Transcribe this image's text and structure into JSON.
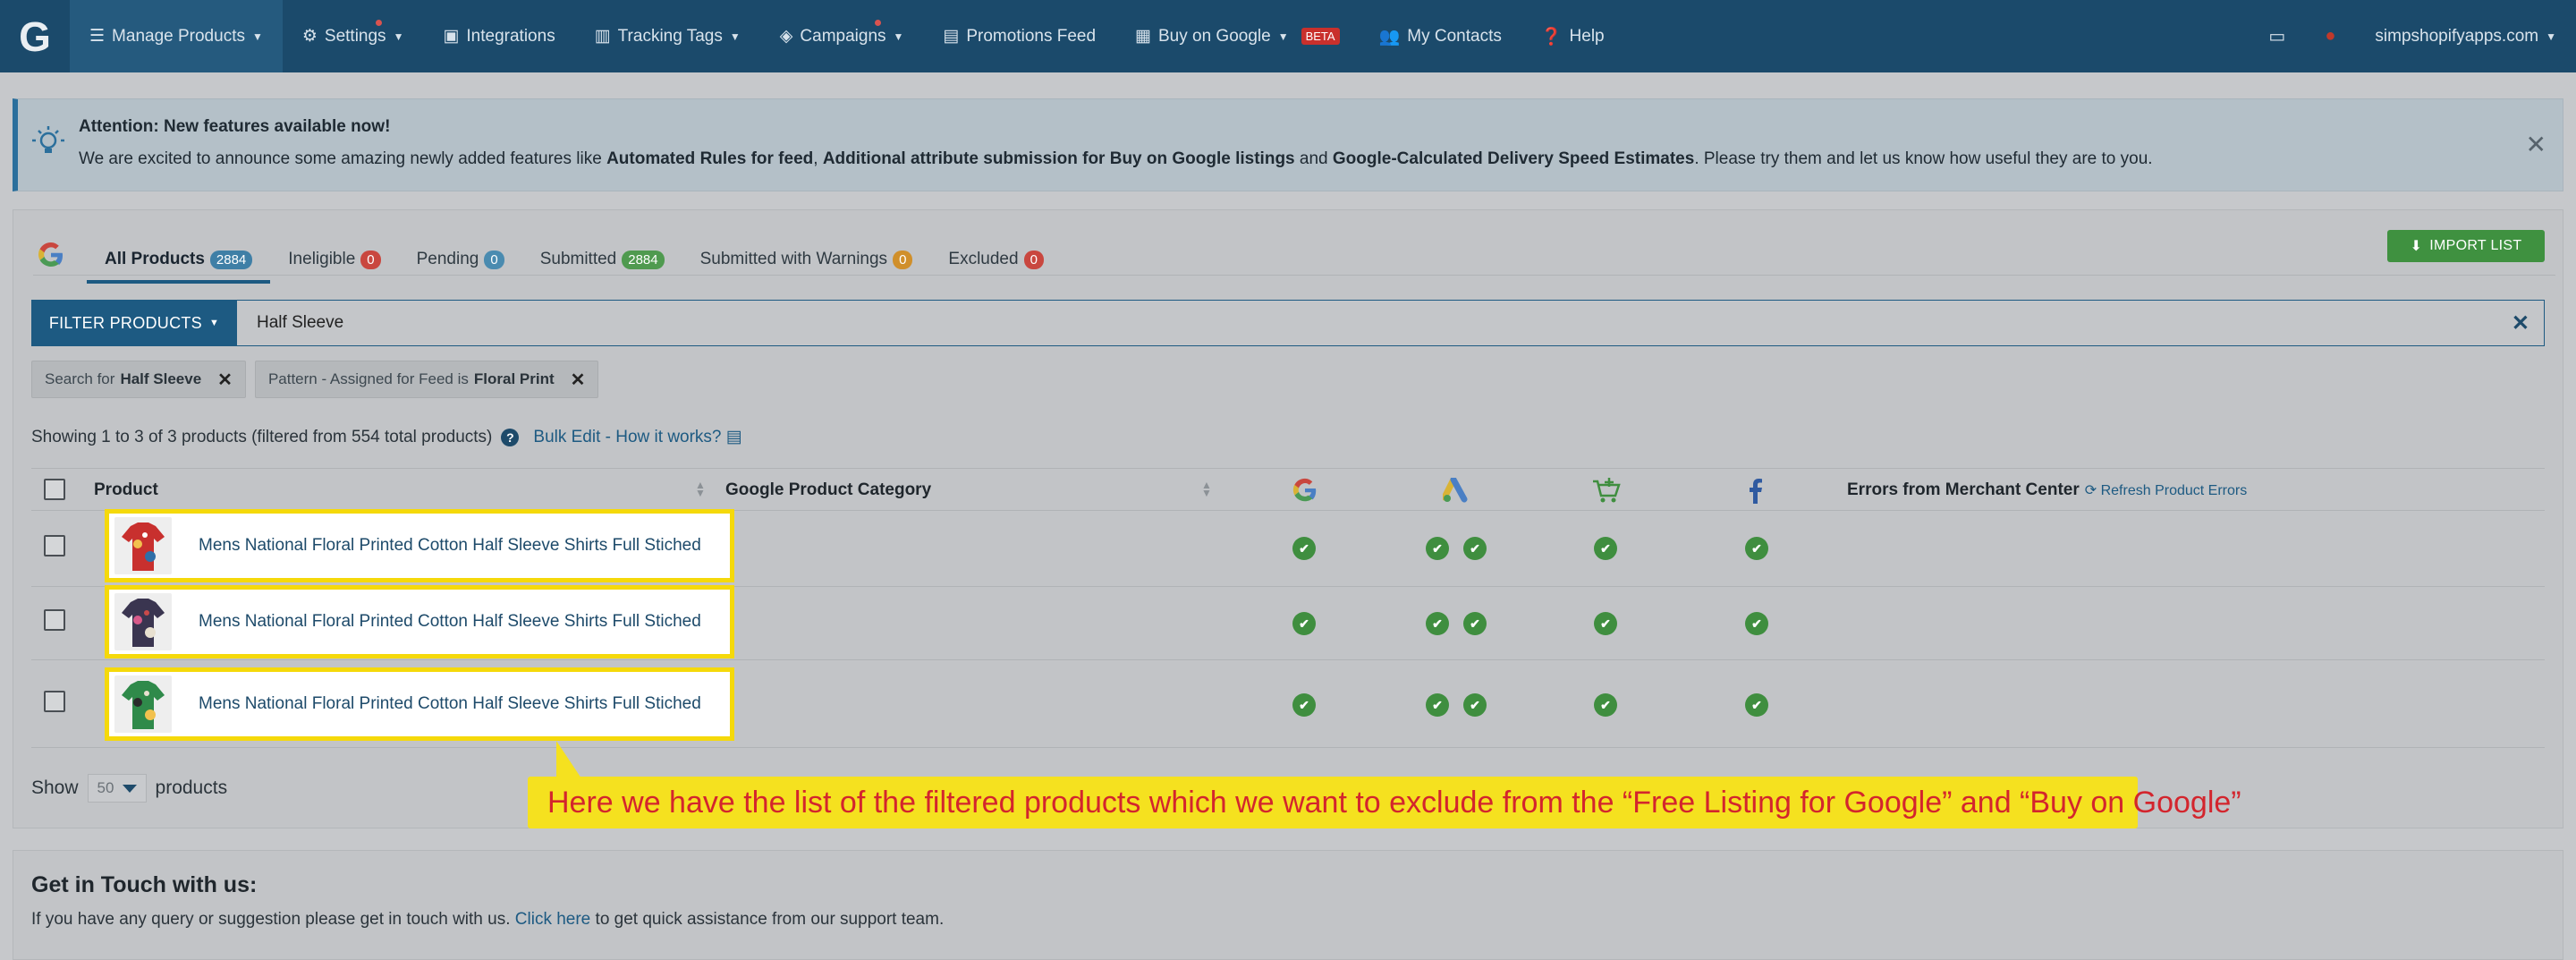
{
  "nav": {
    "logo": "G",
    "items": [
      {
        "label": "Manage Products",
        "icon": "list-icon",
        "caret": true
      },
      {
        "label": "Settings",
        "icon": "gear-icon",
        "caret": true,
        "dot": true
      },
      {
        "label": "Integrations",
        "icon": "briefcase-icon"
      },
      {
        "label": "Tracking Tags",
        "icon": "bar-chart-icon",
        "caret": true
      },
      {
        "label": "Campaigns",
        "icon": "tag-icon",
        "caret": true,
        "dot": true
      },
      {
        "label": "Promotions Feed",
        "icon": "document-icon"
      },
      {
        "label": "Buy on Google",
        "icon": "clipboard-icon",
        "caret": true,
        "badge": "BETA"
      },
      {
        "label": "My Contacts",
        "icon": "contacts-icon"
      },
      {
        "label": "Help",
        "icon": "help-icon"
      }
    ],
    "account": "simpshopifyapps.com"
  },
  "alert": {
    "title": "Attention: New features available now!",
    "body_pre": "We are excited to announce some amazing newly added features like ",
    "f1": "Automated Rules for feed",
    "sep1": ", ",
    "f2": "Additional attribute submission for Buy on Google listings",
    "sep2": " and ",
    "f3": "Google-Calculated Delivery Speed Estimates",
    "body_post": ". Please try them and let us know how useful they are to you.",
    "close": "✕"
  },
  "tabs": [
    {
      "label": "All Products",
      "count": "2884",
      "color": "blue"
    },
    {
      "label": "Ineligible",
      "count": "0",
      "color": "red"
    },
    {
      "label": "Pending",
      "count": "0",
      "color": "lblue"
    },
    {
      "label": "Submitted",
      "count": "2884",
      "color": "green"
    },
    {
      "label": "Submitted with Warnings",
      "count": "0",
      "color": "orange"
    },
    {
      "label": "Excluded",
      "count": "0",
      "color": "red"
    }
  ],
  "import_label": "IMPORT LIST",
  "filter": {
    "button": "FILTER PRODUCTS",
    "value": "Half Sleeve",
    "chips": [
      {
        "prefix": "Search for ",
        "bold": "Half Sleeve"
      },
      {
        "prefix": "Pattern - Assigned for Feed is ",
        "bold": "Floral Print"
      }
    ]
  },
  "showing": "Showing 1 to 3 of 3 products (filtered from 554 total products)",
  "bulk_edit": "Bulk Edit - How it works?",
  "table": {
    "col_product": "Product",
    "col_category": "Google Product Category",
    "col_errors": "Errors from Merchant Center",
    "refresh": "Refresh Product Errors",
    "rows": [
      {
        "title": "Mens National Floral Printed Cotton Half Sleeve Shirts Full Stiched",
        "shirt": "#c8302e"
      },
      {
        "title": "Mens National Floral Printed Cotton Half Sleeve Shirts Full Stiched",
        "shirt": "#3a3550"
      },
      {
        "title": "Mens National Floral Printed Cotton Half Sleeve Shirts Full Stiched",
        "shirt": "#2f8a4a"
      }
    ]
  },
  "show": {
    "pre": "Show",
    "value": "50",
    "post": "products"
  },
  "callout": "Here we have the list of the filtered products which we want to exclude from the “Free Listing for Google” and “Buy on Google”",
  "footer": {
    "title": "Get in Touch with us:",
    "pre": "If you have any query or suggestion please get in touch with us. ",
    "link": "Click here",
    "post": " to get quick assistance from our support team."
  }
}
